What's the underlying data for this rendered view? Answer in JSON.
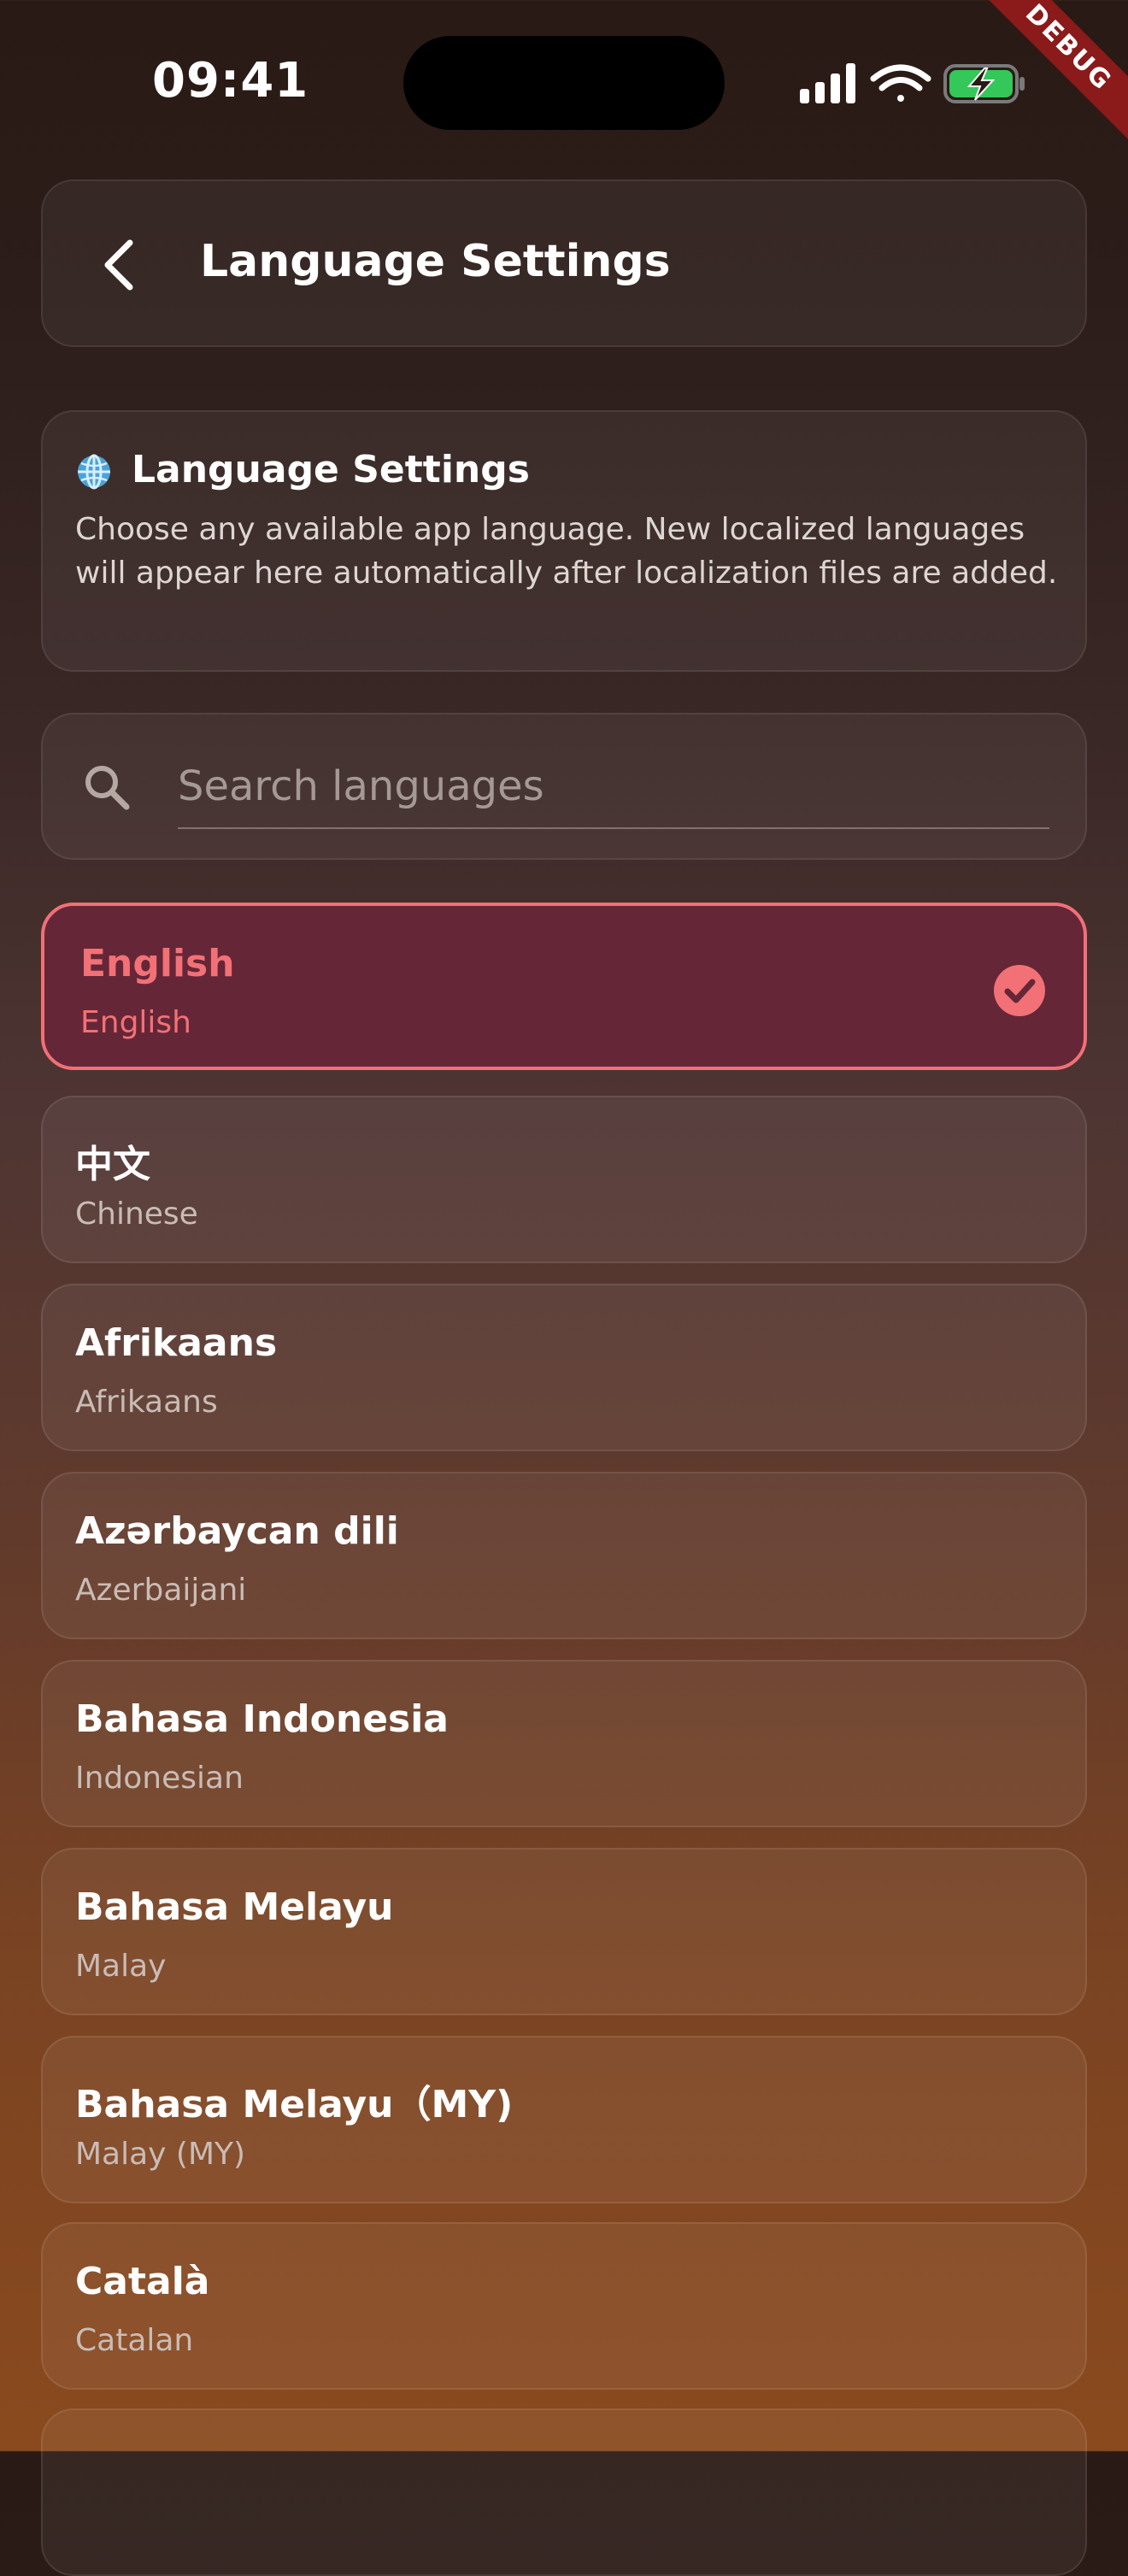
{
  "status_bar": {
    "time": "09:41",
    "debug_label": "DEBUG"
  },
  "header": {
    "title": "Language Settings"
  },
  "info": {
    "title": "Language Settings",
    "description": "Choose any available app language. New localized languages will appear here automatically after localization files are added."
  },
  "search": {
    "placeholder": "Search languages",
    "value": ""
  },
  "languages": [
    {
      "native": "English",
      "english": "English",
      "selected": true
    },
    {
      "native": "中文",
      "english": "Chinese",
      "selected": false
    },
    {
      "native": "Afrikaans",
      "english": "Afrikaans",
      "selected": false
    },
    {
      "native": "Azərbaycan dili",
      "english": "Azerbaijani",
      "selected": false
    },
    {
      "native": "Bahasa Indonesia",
      "english": "Indonesian",
      "selected": false
    },
    {
      "native": "Bahasa Melayu",
      "english": "Malay",
      "selected": false
    },
    {
      "native": "Bahasa Melayu（MY)",
      "english": "Malay (MY)",
      "selected": false
    },
    {
      "native": "Català",
      "english": "Catalan",
      "selected": false
    }
  ],
  "colors": {
    "accent": "#f27176",
    "selected_background": "#652638",
    "battery_green": "#34c759"
  },
  "icons": {
    "back": "chevron-left-icon",
    "info": "globe-icon",
    "search": "search-icon",
    "selected": "check-circle-icon"
  }
}
